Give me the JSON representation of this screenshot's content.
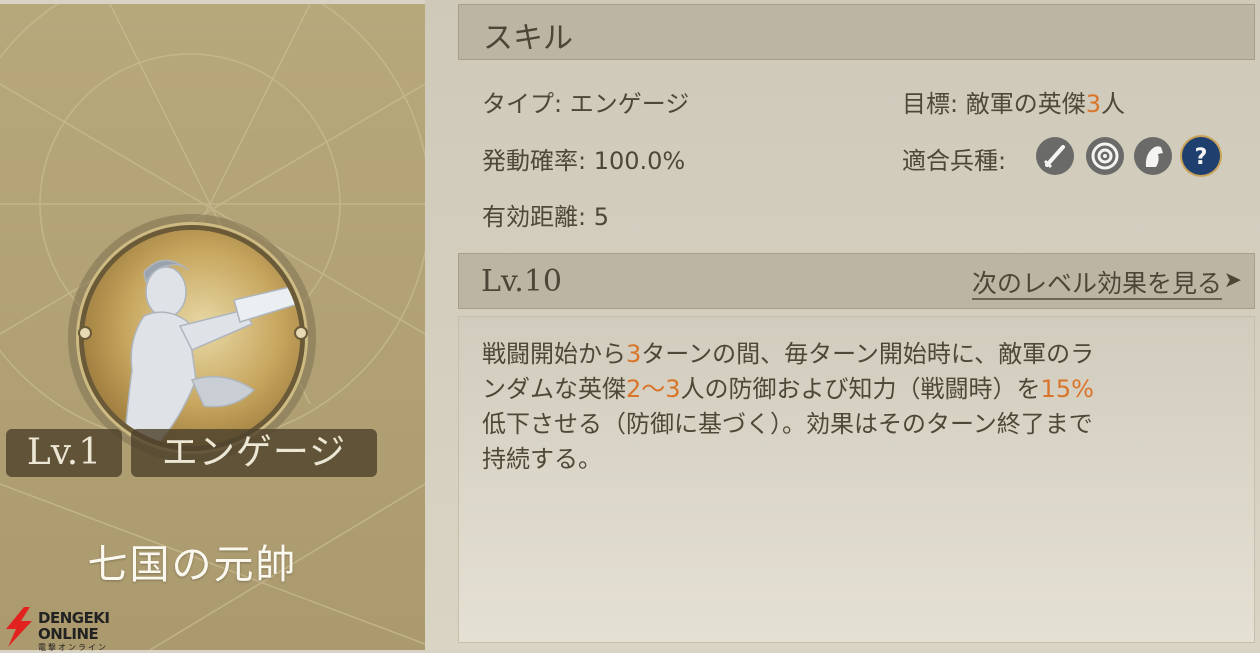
{
  "left": {
    "level": "Lv.1",
    "skill_type_badge": "エンゲージ",
    "skill_name": "七国の元帥"
  },
  "watermark": {
    "line1": "DENGEKI",
    "line2": "ONLINE",
    "line3": "電撃オンライン"
  },
  "header": {
    "title": "スキル"
  },
  "stats": {
    "type": "タイプ: エンゲージ",
    "rate": "発動確率: 100.0%",
    "range": "有効距離: 5",
    "target_prefix": "目標: 敵軍の英傑",
    "target_count": "3",
    "target_suffix": "人",
    "units_label": "適合兵種:"
  },
  "unit_icons": [
    "sword-icon",
    "bow-target-icon",
    "horse-icon",
    "question-icon"
  ],
  "level_bar": {
    "level": "Lv.10",
    "next_label": "次のレベル効果を見る",
    "arrow": "➤"
  },
  "description": {
    "l1a": "戦闘開始から",
    "l1b": "3",
    "l1c": "ターンの間、毎ターン開始時に、敵軍のラ",
    "l2a": "ンダムな英傑",
    "l2b": "2～3",
    "l2c": "人の防御および知力（戦闘時）を",
    "l2d": "15%",
    "l3": "低下させる（防御に基づく）。効果はそのターン終了まで",
    "l4": "持続する。"
  },
  "colors": {
    "accent": "#d9752a",
    "text": "#4e4839",
    "left_panel": "#b7a87c"
  }
}
